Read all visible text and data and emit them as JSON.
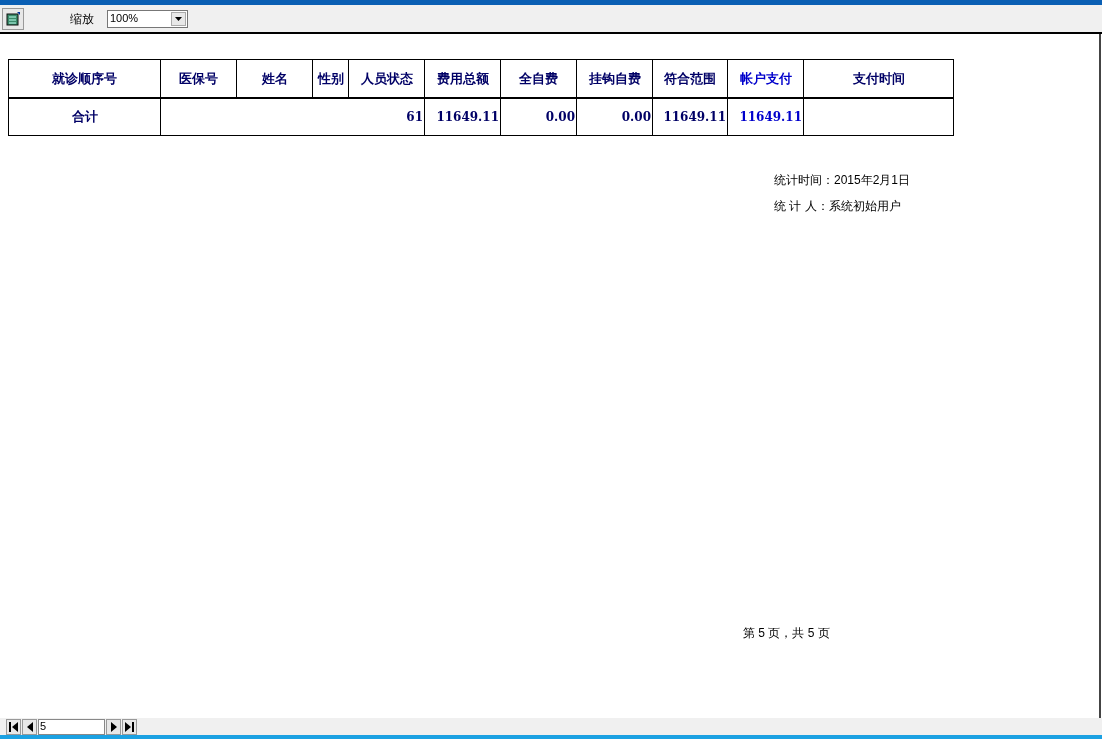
{
  "toolbar": {
    "zoom_label": "缩放",
    "zoom_value": "100%"
  },
  "table": {
    "columns": [
      {
        "label": "就诊顺序号",
        "color": "#000066"
      },
      {
        "label": "医保号",
        "color": "#000066"
      },
      {
        "label": "姓名",
        "color": "#000066"
      },
      {
        "label": "性别",
        "color": "#000066"
      },
      {
        "label": "人员状态",
        "color": "#000066"
      },
      {
        "label": "费用总额",
        "color": "#000066"
      },
      {
        "label": "全自费",
        "color": "#000066"
      },
      {
        "label": "挂钩自费",
        "color": "#000066"
      },
      {
        "label": "符合范围",
        "color": "#000066"
      },
      {
        "label": "帐户支付",
        "color": "#0000cc"
      },
      {
        "label": "支付时间",
        "color": "#000066"
      }
    ],
    "totals": {
      "label": "合计",
      "count": "61",
      "values": [
        "11649.11",
        "0.00",
        "0.00",
        "11649.11",
        "11649.11"
      ]
    }
  },
  "footer_lines": [
    "统计时间：2015年2月1日",
    "统 计 人：系统初始用户"
  ],
  "page_info": "第 5 页，共 5 页",
  "navigator": {
    "page": "5"
  }
}
